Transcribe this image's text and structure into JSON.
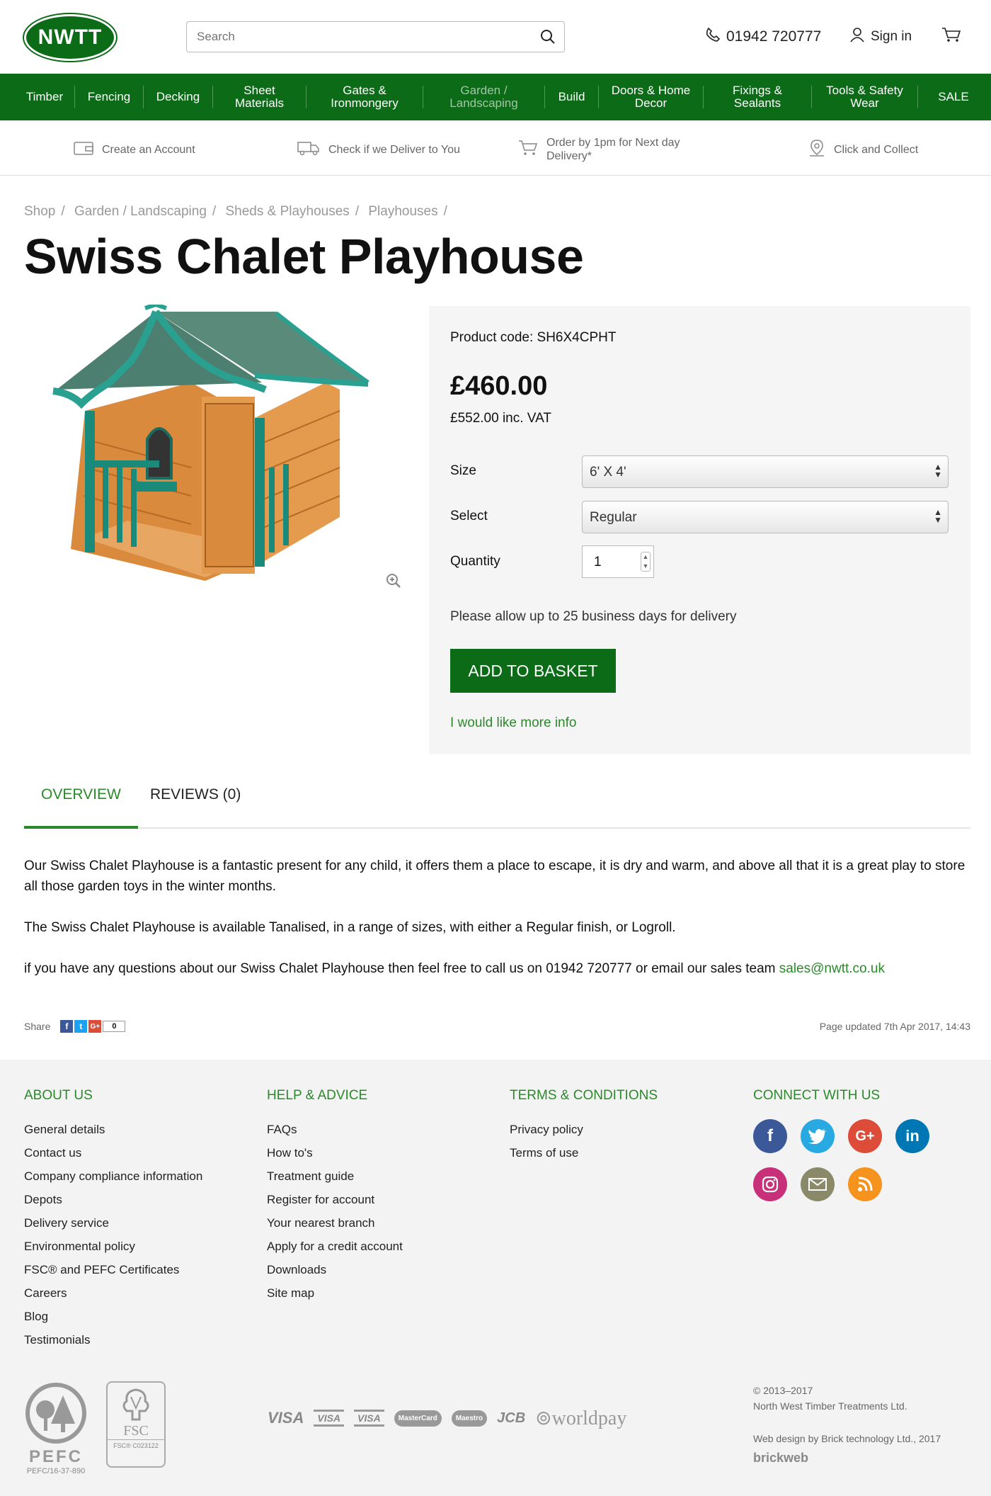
{
  "header": {
    "logo_text": "NWTT",
    "search_placeholder": "Search",
    "phone": "01942 720777",
    "sign_in": "Sign in"
  },
  "nav": {
    "items": [
      "Timber",
      "Fencing",
      "Decking",
      "Sheet Materials",
      "Gates & Ironmongery",
      "Garden / Landscaping",
      "Build",
      "Doors & Home Decor",
      "Fixings & Sealants",
      "Tools & Safety Wear",
      "SALE"
    ]
  },
  "usp": {
    "create_account": "Create an Account",
    "check_deliver": "Check if we Deliver to You",
    "order_by": "Order by 1pm for Next day Delivery*",
    "click_collect": "Click and Collect"
  },
  "breadcrumb": {
    "items": [
      "Shop",
      "Garden / Landscaping",
      "Sheds & Playhouses",
      "Playhouses"
    ],
    "sep": "/"
  },
  "product": {
    "title": "Swiss Chalet Playhouse",
    "code": "Product code: SH6X4CPHT",
    "price": "£460.00",
    "price_vat": "£552.00  inc. VAT",
    "size_label": "Size",
    "size_value": "6' X 4'",
    "select_label": "Select",
    "select_value": "Regular",
    "quantity_label": "Quantity",
    "quantity_value": "1",
    "delivery_note": "Please allow up to 25 business days for delivery",
    "add_to_basket": "ADD TO BASKET",
    "more_info": "I would like more info"
  },
  "tabs": {
    "overview": "OVERVIEW",
    "reviews": "REVIEWS (0)"
  },
  "overview": {
    "p1": "Our Swiss Chalet Playhouse is a fantastic present for any child, it offers them a place to escape, it is dry and warm, and above all that it is a great play to store all those garden toys in the winter months.",
    "p2": "The Swiss Chalet Playhouse is available Tanalised, in a range of sizes, with either a Regular finish, or Logroll.",
    "p3": "if you have any questions about our Swiss Chalet Playhouse then feel free to call us on 01942 720777 or email our sales team ",
    "email": "sales@nwtt.co.uk"
  },
  "share": {
    "label": "Share",
    "count": "0",
    "updated": "Page updated 7th Apr 2017, 14:43"
  },
  "footer": {
    "about": {
      "title": "ABOUT US",
      "links": [
        "General details",
        "Contact us",
        "Company compliance information",
        "Depots",
        "Delivery service",
        "Environmental policy",
        "FSC® and PEFC Certificates",
        "Careers",
        "Blog",
        "Testimonials"
      ]
    },
    "help": {
      "title": "HELP & ADVICE",
      "links": [
        "FAQs",
        "How to's",
        "Treatment guide",
        "Register for account",
        "Your nearest branch",
        "Apply for a credit account",
        "Downloads",
        "Site map"
      ]
    },
    "terms": {
      "title": "TERMS & CONDITIONS",
      "links": [
        "Privacy policy",
        "Terms of use"
      ]
    },
    "connect": {
      "title": "CONNECT WITH US"
    },
    "pefc_code": "PEFC/16-37-890",
    "fsc_code": "FSC® C023122",
    "copyright": "© 2013–2017",
    "company": "North West Timber Treatments Ltd.",
    "webdesign": "Web design by Brick technology Ltd., 2017",
    "brickweb": "brickweb"
  },
  "colors": {
    "brand_green": "#0b6b17",
    "link_green": "#2a8a2a"
  }
}
